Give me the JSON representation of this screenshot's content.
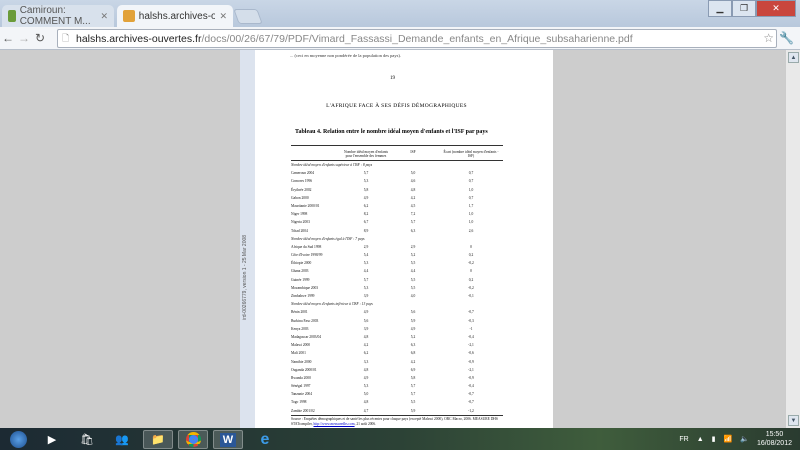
{
  "tabs": [
    {
      "label": "Camiroun: COMMENT M...",
      "active": false
    },
    {
      "label": "halshs.archives-ouvertes.fr",
      "active": true
    }
  ],
  "address": {
    "host": "halshs.archives-ouvertes.fr",
    "path": "/docs/00/26/67/79/PDF/Vimard_Fassassi_Demande_enfants_en_Afrique_subsaharienne.pdf"
  },
  "page1": {
    "text": "... (ceci en moyenne non pondérée de la population des pays).",
    "page_number": "19"
  },
  "page2": {
    "side_stamp": "ird-00266779, version 1 - 25 Mar 2008",
    "running_head": "L'AFRIQUE FACE À SES DÉFIS DÉMOGRAPHIQUES",
    "table_title": "Tableau 4. Relation entre le nombre idéal moyen d'enfants et l'ISF par pays",
    "headers": [
      "Nombre idéal moyen d'enfants pour l'ensemble des femmes",
      "ISF",
      "Écart (nombre idéal moyen d'enfants - ISF)"
    ],
    "sections": [
      {
        "title": "Nombre idéal moyen d'enfants supérieur à l'ISF : 8 pays",
        "rows": [
          [
            "Cameroun 2004",
            "5,7",
            "5,0",
            "0,7"
          ],
          [
            "Comores 1996",
            "5,3",
            "4,6",
            "0,7"
          ],
          [
            "Érythrée 2002",
            "5,8",
            "4,8",
            "1,0"
          ],
          [
            "Gabon 2000",
            "4,9",
            "4,2",
            "0,7"
          ],
          [
            "Mauritanie 2000/01",
            "6,2",
            "4,5",
            "1,7"
          ],
          [
            "Niger 1998",
            "8,2",
            "7,2",
            "1,0"
          ],
          [
            "Nigeria 2003",
            "6,7",
            "5,7",
            "1,0"
          ],
          [
            "Tchad 2004",
            "8,9",
            "6,3",
            "2,6"
          ]
        ]
      },
      {
        "title": "Nombre idéal moyen d'enfants égal à l'ISF : 7 pays",
        "rows": [
          [
            "Afrique du Sud 1998",
            "2,9",
            "2,9",
            "0"
          ],
          [
            "Côte d'Ivoire 1998/99",
            "5,4",
            "5,2",
            "0,2"
          ],
          [
            "Éthiopie 2000",
            "5,3",
            "5,5",
            "-0,2"
          ],
          [
            "Ghana 2003",
            "4,4",
            "4,4",
            "0"
          ],
          [
            "Guinée 1999",
            "5,7",
            "5,5",
            "0,2"
          ],
          [
            "Mozambique 2003",
            "5,3",
            "5,5",
            "-0,2"
          ],
          [
            "Zimbabwe 1999",
            "3,9",
            "4,0",
            "-0,1"
          ]
        ]
      },
      {
        "title": "Nombre idéal moyen d'enfants inférieur à l'ISF : 13 pays",
        "rows": [
          [
            "Bénin 2001",
            "4,9",
            "5,6",
            "-0,7"
          ],
          [
            "Burkina Faso 2003",
            "5,6",
            "5,9",
            "-0,3"
          ],
          [
            "Kenya 2003",
            "3,9",
            "4,9",
            "-1"
          ],
          [
            "Madagascar 2003/04",
            "4,8",
            "5,2",
            "-0,4"
          ],
          [
            "Malawi 2000",
            "4,2",
            "6,3",
            "-2,1"
          ],
          [
            "Mali 2001",
            "6,2",
            "6,8",
            "-0,6"
          ],
          [
            "Namibie 2000",
            "3,3",
            "4,2",
            "-0,9"
          ],
          [
            "Ouganda 2000/01",
            "4,8",
            "6,9",
            "-2,1"
          ],
          [
            "Rwanda 2000",
            "4,9",
            "5,8",
            "-0,9"
          ],
          [
            "Sénégal 1997",
            "5,3",
            "5,7",
            "-0,4"
          ],
          [
            "Tanzanie 2004",
            "5,0",
            "5,7",
            "-0,7"
          ],
          [
            "Togo 1998",
            "4,8",
            "5,5",
            "-0,7"
          ],
          [
            "Zambie 2001/02",
            "4,7",
            "5,9",
            "-1,2"
          ]
        ]
      }
    ],
    "source_text": "Source : Enquêtes démographiques et de santé les plus récentes pour chaque pays (excepté Malawi 2000), ORC Macro, 2006. MEASURE DHS STATcompiler,",
    "source_link": "http://www.measuredhs.com",
    "source_date": ", 21 août 2006."
  },
  "taskbar": {
    "language": "FR",
    "time": "15:50",
    "date": "16/08/2012"
  }
}
